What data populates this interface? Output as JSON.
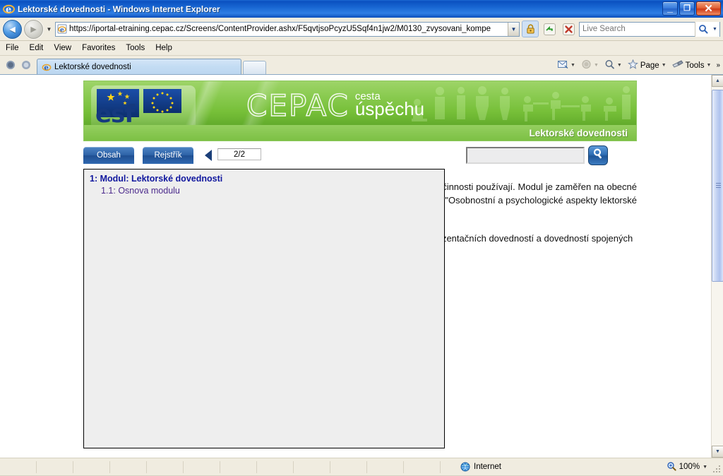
{
  "window": {
    "title": "Lektorské dovednosti - Windows Internet Explorer",
    "minimize_label": "_",
    "restore_label": "❐",
    "close_label": "✕"
  },
  "address_bar": {
    "back_label": "◄",
    "forward_label": "►",
    "history_caret": "▼",
    "url": "https://iportal-etraining.cepac.cz/Screens/ContentProvider.ashx/F5qvtjsoPcyzU5Sqf4n1jw2/M0130_zvysovani_kompe",
    "url_dropdown": "▼",
    "lock_icon": "lock-icon",
    "refresh_icon": "refresh-icon",
    "stop_icon": "stop-icon",
    "search_placeholder": "Live Search",
    "search_value": "",
    "search_dropdown": "▼"
  },
  "menu": {
    "items": [
      "File",
      "Edit",
      "View",
      "Favorites",
      "Tools",
      "Help"
    ]
  },
  "tabs": {
    "active_tab_label": "Lektorské dovednosti",
    "new_tab_label": "",
    "right_tools": [
      {
        "label": "",
        "icon": "mail-icon",
        "caret": "▼",
        "dim": false
      },
      {
        "label": "",
        "icon": "home-icon",
        "caret": "▼",
        "dim": true
      },
      {
        "label": "",
        "icon": "feeds-icon",
        "caret": "▼",
        "dim": false
      },
      {
        "label": "Page",
        "icon": "page-star-icon",
        "caret": "▼",
        "dim": false
      },
      {
        "label": "Tools",
        "icon": "tools-icon",
        "caret": "▼",
        "dim": false
      }
    ],
    "overflow_chevron": "»"
  },
  "banner": {
    "esf_label": "esf",
    "brand": "CEPAC",
    "tagline_small": "cesta",
    "tagline_large": "úspěchu",
    "module_title": "Lektorské dovednosti",
    "accent_color": "#76bf38"
  },
  "content_tools": {
    "obsah_label": "Obsah",
    "rejstrik_label": "Rejstřík",
    "prev_label": "◀",
    "page_indicator": "2/2",
    "search_value": "",
    "search_placeholder": "",
    "search_icon": "search-icon"
  },
  "toc": {
    "items": [
      {
        "label": "1: Modul: Lektorské dovednosti",
        "level": 1
      },
      {
        "label": "1.1: Osnova modulu",
        "level": 2
      }
    ]
  },
  "content": {
    "paragraphs": [
      "Modul se zabývá lektorskou činností. Zahrnuje základní dovednosti, které lektoři při své činnosti používají. Modul je zaměřen na obecné dovednosti bez ohledu na obsah jednotlivých předmětů. Tento modul navazuje na modul \"Osobnostní a psychologické aspekty lektorské činnosti\",",
      "Modul se zabývá lektorskými dovednostmi. Účastník získá základní přehled v oblasti prezentačních dovedností a dovedností spojených"
    ]
  },
  "scrollbar": {
    "up_label": "▲",
    "down_label": "▼"
  },
  "status_bar": {
    "zone_label": "Internet",
    "zone_icon": "globe-icon",
    "zoom_label": "100%",
    "zoom_icon": "zoom-icon",
    "zoom_caret": "▼"
  }
}
